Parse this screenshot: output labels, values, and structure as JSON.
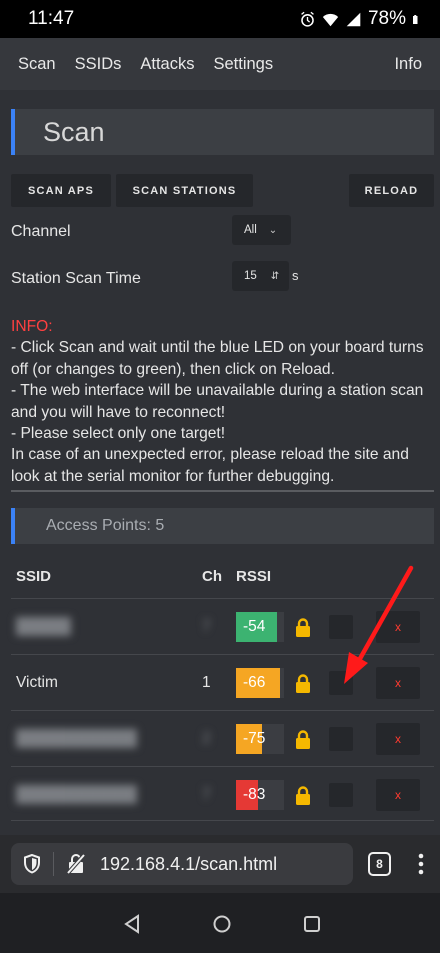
{
  "status": {
    "time": "11:47",
    "battery": "78%"
  },
  "nav": {
    "links": [
      "Scan",
      "SSIDs",
      "Attacks",
      "Settings"
    ],
    "info": "Info"
  },
  "page": {
    "title": "Scan"
  },
  "buttons": {
    "scan_aps": "SCAN APS",
    "scan_stations": "SCAN STATIONS",
    "reload": "RELOAD"
  },
  "form": {
    "channel_label": "Channel",
    "channel_value": "All",
    "scan_time_label": "Station Scan Time",
    "scan_time_value": "15",
    "scan_time_unit": "s"
  },
  "info": {
    "title": "INFO:",
    "lines": [
      "- Click Scan and wait until the blue LED on your board turns off (or changes to green), then click on Reload.",
      "- The web interface will be unavailable during a station scan and you will have to reconnect!",
      "- Please select only one target!",
      "In case of an unexpected error, please reload the site and look at the serial monitor for further debugging."
    ]
  },
  "access_points": {
    "header": "Access Points: 5",
    "columns": {
      "ssid": "SSID",
      "ch": "Ch",
      "rssi": "RSSI"
    },
    "rows": [
      {
        "ssid": "█████",
        "ch": "7",
        "rssi": "-54",
        "rssi_color": "#3cb371",
        "rssi_fill": 0.85,
        "blurred": true,
        "delete": "x"
      },
      {
        "ssid": "Victim",
        "ch": "1",
        "rssi": "-66",
        "rssi_color": "#f5a623",
        "rssi_fill": 0.92,
        "blurred": false,
        "delete": "x"
      },
      {
        "ssid": "███████████",
        "ch": "2",
        "rssi": "-75",
        "rssi_color": "#f5a623",
        "rssi_fill": 0.55,
        "blurred": true,
        "delete": "x"
      },
      {
        "ssid": "███████████",
        "ch": "7",
        "rssi": "-83",
        "rssi_color": "#e53935",
        "rssi_fill": 0.45,
        "blurred": true,
        "delete": "x"
      }
    ]
  },
  "browser": {
    "url": "192.168.4.1/scan.html",
    "tab_count": "8"
  },
  "colors": {
    "accent": "#3b82f6",
    "danger": "#ff3b30",
    "lock": "#f5b800",
    "arrow": "#ff1a1a"
  }
}
